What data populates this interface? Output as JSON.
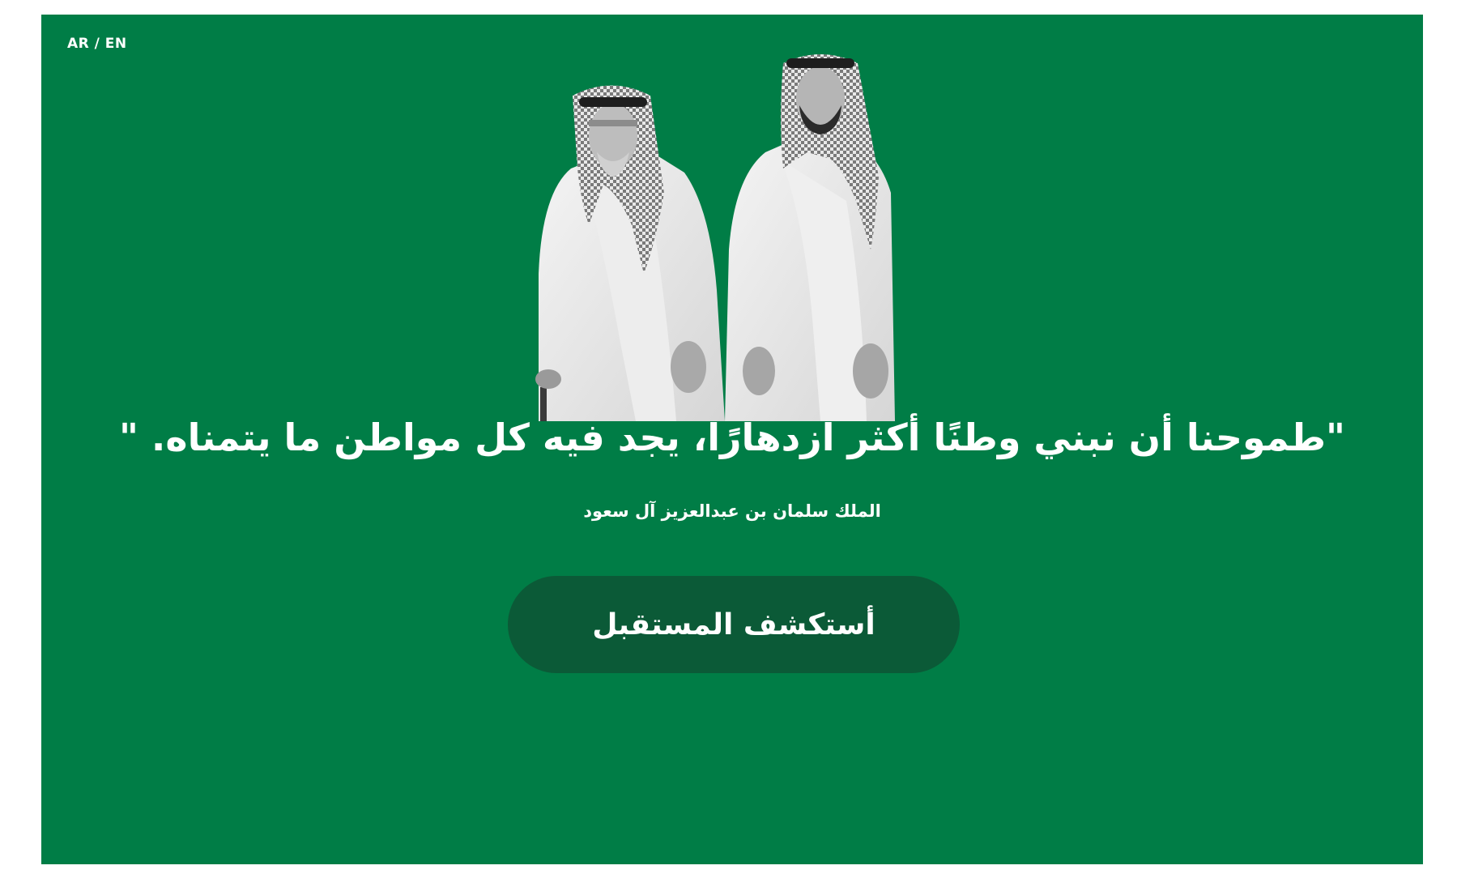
{
  "header": {
    "language_switch": "AR / EN"
  },
  "hero": {
    "portrait_alt": "portrait",
    "quote": "\"طموحنا أن نبني وطنًا أكثر ازدهارًا، يجد فيه كل مواطن ما يتمناه. \"",
    "attribution": "الملك سلمان بن عبدالعزيز آل سعود",
    "cta_label": "أستكشف المستقبل"
  },
  "colors": {
    "background": "#007d46",
    "button": "#0b5a37",
    "text": "#ffffff"
  }
}
